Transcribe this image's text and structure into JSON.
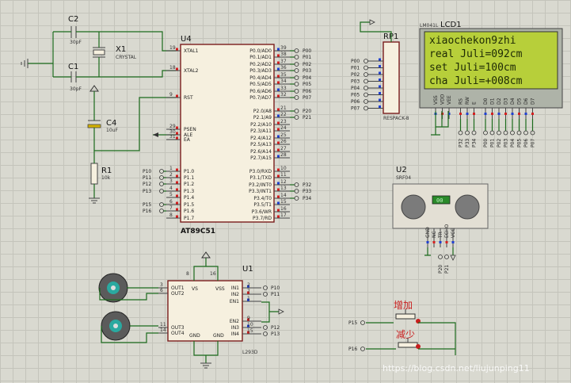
{
  "components": {
    "c2": {
      "ref": "C2",
      "value": "30pF"
    },
    "c1": {
      "ref": "C1",
      "value": "30pF"
    },
    "x1": {
      "ref": "X1",
      "value": "CRYSTAL"
    },
    "c4": {
      "ref": "C4",
      "value": "10uF"
    },
    "r1": {
      "ref": "R1",
      "value": "10k"
    },
    "u4": {
      "ref": "U4",
      "part": "AT89C51",
      "left_pins": [
        {
          "num": "19",
          "label": "XTAL1",
          "net": ""
        },
        {
          "num": "18",
          "label": "XTAL2",
          "net": ""
        },
        {
          "num": "9",
          "label": "RST",
          "net": ""
        },
        {
          "num": "29",
          "label": "PSEN",
          "net": ""
        },
        {
          "num": "30",
          "label": "ALE",
          "net": ""
        },
        {
          "num": "31",
          "label": "EA",
          "net": ""
        },
        {
          "num": "1",
          "label": "P1.0",
          "net": "P10"
        },
        {
          "num": "2",
          "label": "P1.1",
          "net": "P11"
        },
        {
          "num": "3",
          "label": "P1.2",
          "net": "P12"
        },
        {
          "num": "4",
          "label": "P1.3",
          "net": "P13"
        },
        {
          "num": "5",
          "label": "P1.4",
          "net": ""
        },
        {
          "num": "6",
          "label": "P1.5",
          "net": "P15"
        },
        {
          "num": "7",
          "label": "P1.6",
          "net": "P16"
        },
        {
          "num": "8",
          "label": "P1.7",
          "net": ""
        }
      ],
      "right_pins": [
        {
          "num": "39",
          "label": "P0.0/AD0",
          "net": "P00"
        },
        {
          "num": "38",
          "label": "P0.1/AD1",
          "net": "P01"
        },
        {
          "num": "37",
          "label": "P0.2/AD2",
          "net": "P02"
        },
        {
          "num": "36",
          "label": "P0.3/AD3",
          "net": "P03"
        },
        {
          "num": "35",
          "label": "P0.4/AD4",
          "net": "P04"
        },
        {
          "num": "34",
          "label": "P0.5/AD5",
          "net": "P05"
        },
        {
          "num": "33",
          "label": "P0.6/AD6",
          "net": "P06"
        },
        {
          "num": "32",
          "label": "P0.7/AD7",
          "net": "P07"
        },
        {
          "num": "21",
          "label": "P2.0/A8",
          "net": "P20"
        },
        {
          "num": "22",
          "label": "P2.1/A9",
          "net": "P21"
        },
        {
          "num": "23",
          "label": "P2.2/A10",
          "net": ""
        },
        {
          "num": "24",
          "label": "P2.3/A11",
          "net": ""
        },
        {
          "num": "25",
          "label": "P2.4/A12",
          "net": ""
        },
        {
          "num": "26",
          "label": "P2.5/A13",
          "net": ""
        },
        {
          "num": "27",
          "label": "P2.6/A14",
          "net": ""
        },
        {
          "num": "28",
          "label": "P2.7/A15",
          "net": ""
        },
        {
          "num": "10",
          "label": "P3.0/RXD",
          "net": ""
        },
        {
          "num": "11",
          "label": "P3.1/TXD",
          "net": ""
        },
        {
          "num": "12",
          "label": "P3.2/INT0",
          "net": "P32"
        },
        {
          "num": "13",
          "label": "P3.3/INT1",
          "net": "P33"
        },
        {
          "num": "14",
          "label": "P3.4/T0",
          "net": "P34"
        },
        {
          "num": "15",
          "label": "P3.5/T1",
          "net": ""
        },
        {
          "num": "16",
          "label": "P3.6/WR",
          "net": ""
        },
        {
          "num": "17",
          "label": "P3.7/RD",
          "net": ""
        }
      ]
    },
    "rp1": {
      "ref": "RP1",
      "part": "RESPACK-8",
      "nets": [
        "P00",
        "P01",
        "P02",
        "P03",
        "P04",
        "P05",
        "P06",
        "P07"
      ]
    },
    "lcd1": {
      "ref": "LCD1",
      "part": "LM041L",
      "lines": [
        "xiaochekon9zhi",
        "real Juli=092cm",
        " set Juli=100cm",
        "cha Juli=+008cm"
      ],
      "pin_labels": [
        "VSS",
        "VDD",
        "VEE",
        "RS",
        "RW",
        "E",
        "D0",
        "D1",
        "D2",
        "D3",
        "D4",
        "D5",
        "D6",
        "D7"
      ],
      "pin_nets": [
        "",
        "",
        "",
        "P32",
        "P33",
        "P34",
        "P00",
        "P01",
        "P02",
        "P03",
        "P04",
        "P05",
        "P06",
        "P07"
      ]
    },
    "u2": {
      "ref": "U2",
      "part": "SRF04",
      "display": "00",
      "pin_labels": [
        "GND",
        "NC",
        "TR",
        "ECHO",
        "VCC"
      ],
      "nets": [
        "P20",
        "P21"
      ]
    },
    "u1": {
      "ref": "U1",
      "part": "L293D",
      "left_pins": [
        {
          "num": "3",
          "label": "OUT1"
        },
        {
          "num": "6",
          "label": "OUT2"
        },
        {
          "num": "11",
          "label": "OUT3"
        },
        {
          "num": "14",
          "label": "OUT4"
        }
      ],
      "top_labels": [
        "VS",
        "VSS"
      ],
      "top_nums": [
        "8",
        "16"
      ],
      "bottom_labels": [
        "GND",
        "GND"
      ],
      "right_pins": [
        {
          "num": "2",
          "label": "IN1",
          "net": "P10"
        },
        {
          "num": "7",
          "label": "IN2",
          "net": "P11"
        },
        {
          "num": "1",
          "label": "EN1",
          "net": ""
        },
        {
          "num": "9",
          "label": "EN2",
          "net": ""
        },
        {
          "num": "10",
          "label": "IN3",
          "net": "P12"
        },
        {
          "num": "15",
          "label": "IN4",
          "net": "P13"
        }
      ]
    },
    "buttons": [
      {
        "label": "增加",
        "net": "P15"
      },
      {
        "label": "减少",
        "net": "P16"
      }
    ]
  },
  "watermark": "https://blog.csdn.net/liujunping11",
  "colors": {
    "wire": "#1c6b1c",
    "body_fill": "#f6f0df",
    "body_stroke": "#7a1c1c",
    "lcd_screen": "#b7cf3a",
    "pin_red": "#d42020",
    "pin_blue": "#2040d0",
    "button_text": "#c81e1e"
  }
}
